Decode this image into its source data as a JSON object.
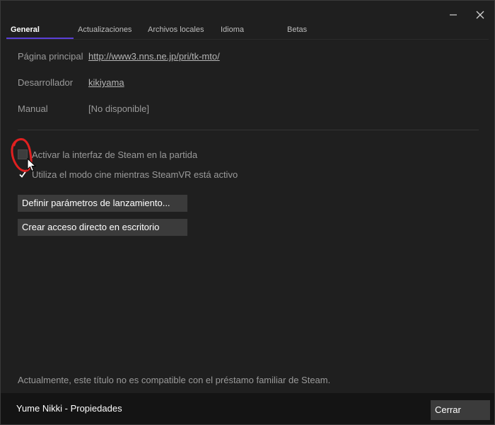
{
  "window": {
    "title": "Yume Nikki - Propiedades"
  },
  "titlebar": {
    "minimize_icon": "minimize-icon",
    "close_icon": "close-icon"
  },
  "tabs": [
    {
      "label": "General",
      "active": true
    },
    {
      "label": "Actualizaciones",
      "active": false
    },
    {
      "label": "Archivos locales",
      "active": false
    },
    {
      "label": "Idioma",
      "active": false
    },
    {
      "label": "Betas",
      "active": false
    }
  ],
  "general": {
    "homepage": {
      "label": "Página principal",
      "value": "http://www3.nns.ne.jp/pri/tk-mto/"
    },
    "developer": {
      "label": "Desarrollador",
      "value": "kikiyama"
    },
    "manual": {
      "label": "Manual",
      "value": "[No disponible]"
    },
    "options": [
      {
        "label": "Activar la interfaz de Steam en la partida",
        "checked": false
      },
      {
        "label": "Utiliza el modo cine mientras SteamVR está activo",
        "checked": true
      }
    ],
    "buttons": {
      "launch_options": "Definir parámetros de lanzamiento...",
      "desktop_shortcut": "Crear acceso directo en escritorio"
    },
    "family_sharing_note": "Actualmente, este título no es compatible con el préstamo familiar de Steam."
  },
  "footer": {
    "close_label": "Cerrar"
  },
  "colors": {
    "accent": "#5a3fd8",
    "annotation": "#e02020",
    "background": "#1f1f1f",
    "bottom_bar": "#141414"
  }
}
